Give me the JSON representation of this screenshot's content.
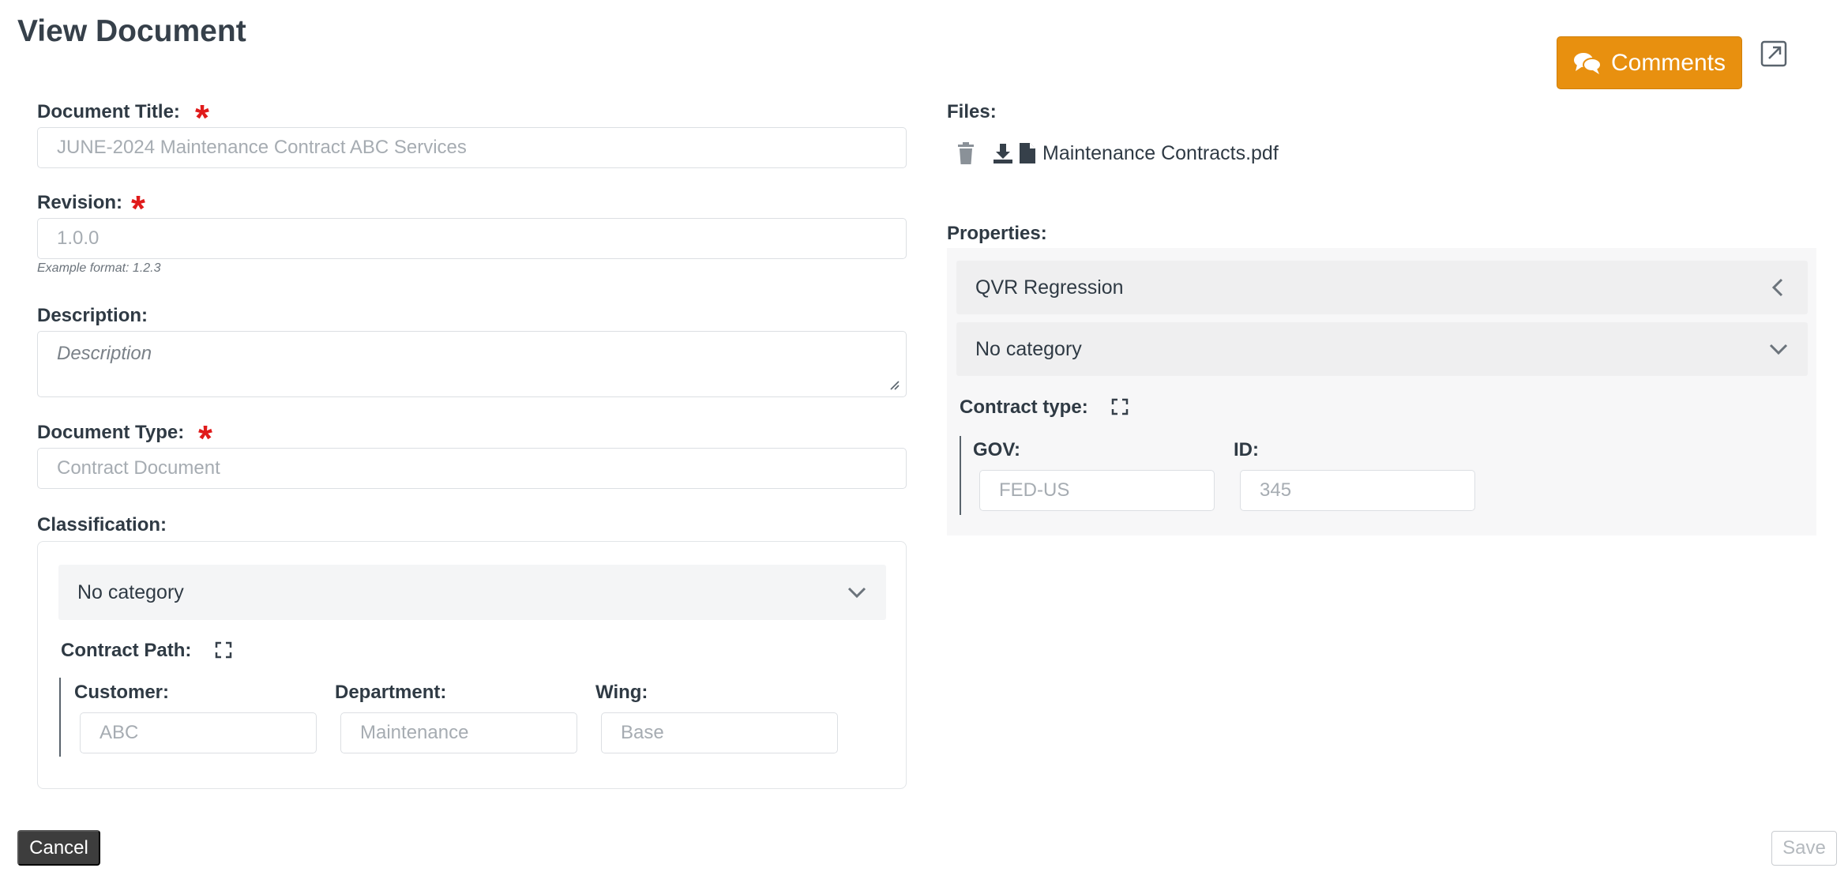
{
  "header": {
    "title": "View Document",
    "comments_label": "Comments"
  },
  "form": {
    "title_label": "Document Title:",
    "title_value": "JUNE-2024 Maintenance Contract ABC Services",
    "revision_label": "Revision:",
    "revision_value": "1.0.0",
    "revision_hint": "Example format: 1.2.3",
    "description_label": "Description:",
    "description_placeholder": "Description",
    "doctype_label": "Document Type:",
    "doctype_value": "Contract Document",
    "required_marker": "*"
  },
  "classification": {
    "label": "Classification:",
    "category": "No category",
    "path_label": "Contract Path:",
    "fields": [
      {
        "label": "Customer:",
        "value": "ABC"
      },
      {
        "label": "Department:",
        "value": "Maintenance"
      },
      {
        "label": "Wing:",
        "value": "Base"
      }
    ]
  },
  "files": {
    "label": "Files:",
    "items": [
      {
        "name": "Maintenance Contracts.pdf"
      }
    ]
  },
  "properties": {
    "label": "Properties:",
    "group_title": "QVR Regression",
    "category": "No category",
    "type_label": "Contract type:",
    "fields": [
      {
        "label": "GOV:",
        "value": "FED-US"
      },
      {
        "label": "ID:",
        "value": "345"
      }
    ]
  },
  "footer": {
    "cancel_label": "Cancel",
    "save_label": "Save"
  },
  "colors": {
    "accent": "#e8900f",
    "required": "#e01b1b",
    "cancel_bg": "#3d3d3d"
  }
}
